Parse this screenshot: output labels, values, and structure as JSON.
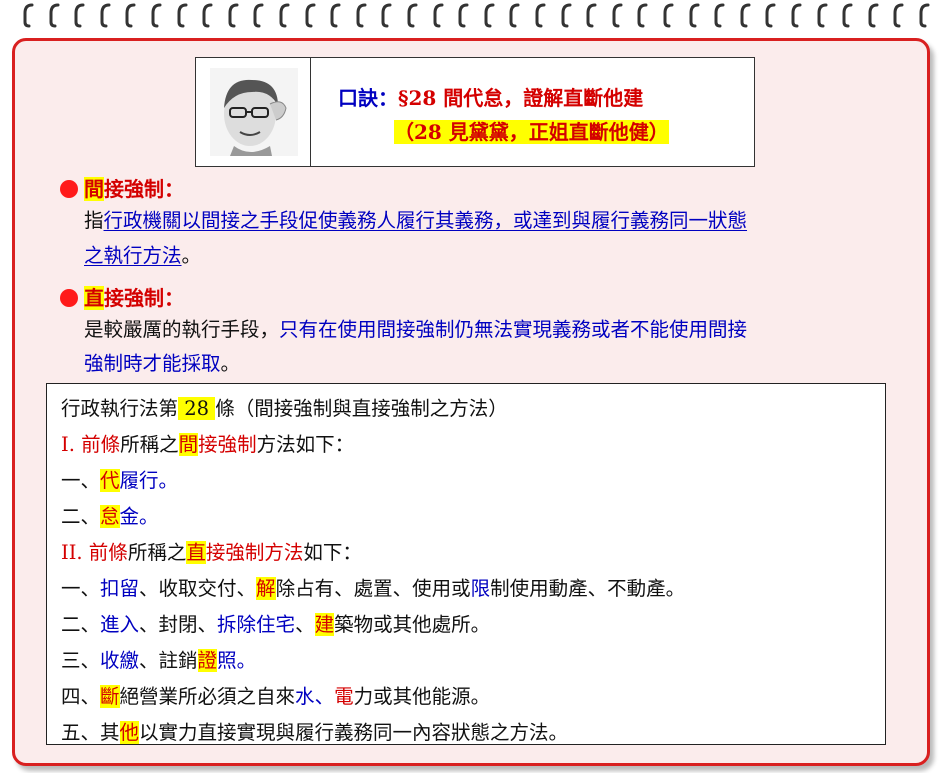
{
  "mnemonic": {
    "label": "口訣：",
    "text": "§28 間代怠，證解直斷他建",
    "line2_open": "（28 見黛黛，",
    "line2_hl": "正姐直斷他健）"
  },
  "indirect": {
    "title_hl": "間",
    "title_rest": "接強制：",
    "desc_prefix": "指",
    "desc_line1": "行政機關以間接之手段促使義務人履行其義務，或達到與履行義務同一狀態",
    "desc_line2": "之執行方法",
    "desc_line2_end": "。"
  },
  "direct": {
    "title_hl": "直",
    "title_rest": "接強制：",
    "desc_line1_a": "是較嚴厲的執行手段，",
    "desc_line1_b": "只有在使用間接強制仍無法實現義務或者不能使用間接",
    "desc_line2_a": "強制時才能採取",
    "desc_line2_b": "。"
  },
  "law": {
    "heading_a": "行政執行法第",
    "heading_num": " 28 ",
    "heading_b": "條（間接強制與直接強制之方法）",
    "s1_num": "I. 前條",
    "s1_a": "所稱之",
    "s1_hl": "間",
    "s1_b": "接強制",
    "s1_c": "方法如下：",
    "i1_pre": "一、",
    "i1_hl": "代",
    "i1_post": "履行。",
    "i2_pre": "二、",
    "i2_hl": "怠",
    "i2_post": "金。",
    "s2_num": "II. 前條",
    "s2_a": "所稱之",
    "s2_hl": "直",
    "s2_b": "接強制方法",
    "s2_c": "如下：",
    "d1_pre": "一、",
    "d1_a": "扣留",
    "d1_b": "、收取交付、",
    "d1_hl": "解",
    "d1_c": "除占有、處置、使用或",
    "d1_d": "限",
    "d1_e": "制使用動產、不動產。",
    "d2_pre": "二、",
    "d2_a": "進入",
    "d2_b": "、封閉、",
    "d2_c": "拆除住宅",
    "d2_d": "、",
    "d2_hl": "建",
    "d2_e": "築物或其他處所。",
    "d3_pre": "三、",
    "d3_a": "收繳",
    "d3_b": "、註銷",
    "d3_hl": "證",
    "d3_c": "照。",
    "d4_pre": "四、",
    "d4_hl": "斷",
    "d4_a": "絕營業所必須之自來",
    "d4_b": "水",
    "d4_c": "、",
    "d4_d": "電",
    "d4_e": "力或其他能源。",
    "d5_pre": "五、其",
    "d5_hl": "他",
    "d5_a": "以實力直接實現與履行義務同一內容狀態之方法。"
  },
  "colors": {
    "red": "#d40000",
    "blue": "#0000c0",
    "highlight": "#ffff00",
    "border": "#d92020"
  },
  "icons": {
    "binding": "spiral-ring-icon",
    "bullet": "red-dot-icon"
  }
}
